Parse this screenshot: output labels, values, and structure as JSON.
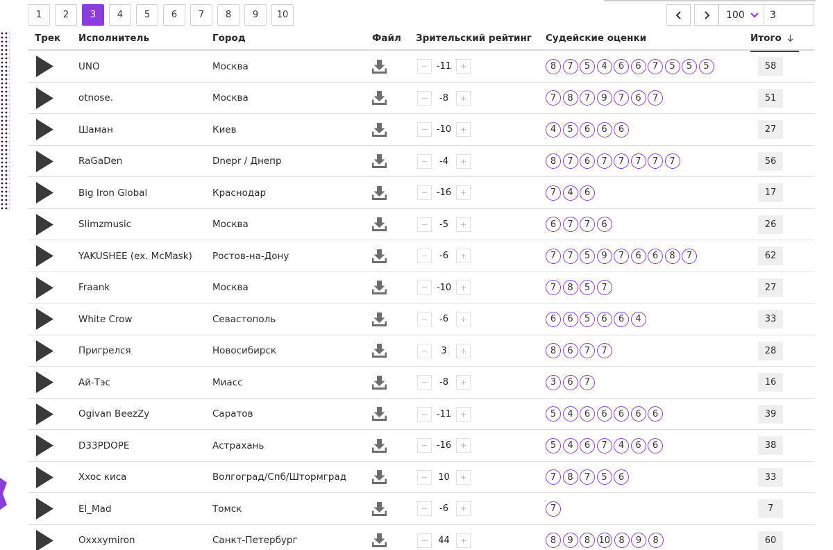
{
  "pagination": {
    "pages": [
      "1",
      "2",
      "3",
      "4",
      "5",
      "6",
      "7",
      "8",
      "9",
      "10"
    ],
    "active_index": 2,
    "per_page": "100",
    "page_input": "3"
  },
  "colors": {
    "accent": "#8a3ddb",
    "dark": "#3a1433"
  },
  "icons": {
    "play": "play-icon",
    "download": "download-icon",
    "prev": "chevron-left-icon",
    "next": "chevron-right-icon",
    "sort": "arrow-down-icon",
    "dropdown": "chevron-down-icon"
  },
  "table": {
    "headers": {
      "track": "Трек",
      "artist": "Исполнитель",
      "city": "Город",
      "file": "Файл",
      "rating": "Зрительский рейтинг",
      "scores": "Судейские оценки",
      "total": "Итого"
    },
    "minus": "−",
    "plus": "+",
    "rows": [
      {
        "artist": "UNO",
        "city": "Москва",
        "rating": "-11",
        "scores": [
          "8",
          "7",
          "5",
          "4",
          "6",
          "6",
          "7",
          "5",
          "5",
          "5"
        ],
        "total": "58"
      },
      {
        "artist": "otnose.",
        "city": "Москва",
        "rating": "-8",
        "scores": [
          "7",
          "8",
          "7",
          "9",
          "7",
          "6",
          "7"
        ],
        "total": "51"
      },
      {
        "artist": "Шаман",
        "city": "Киев",
        "rating": "-10",
        "scores": [
          "4",
          "5",
          "6",
          "6",
          "6"
        ],
        "total": "27"
      },
      {
        "artist": "RaGaDen",
        "city": "Dnepr / Днепр",
        "rating": "-4",
        "scores": [
          "8",
          "7",
          "6",
          "7",
          "7",
          "7",
          "7",
          "7"
        ],
        "total": "56"
      },
      {
        "artist": "Big Iron Global",
        "city": "Краснодар",
        "rating": "-16",
        "scores": [
          "7",
          "4",
          "6"
        ],
        "total": "17"
      },
      {
        "artist": "Slimzmusic",
        "city": "Москва",
        "rating": "-5",
        "scores": [
          "6",
          "7",
          "7",
          "6"
        ],
        "total": "26"
      },
      {
        "artist": "YAKUSHEE (ex. McMask)",
        "city": "Ростов-на-Дону",
        "rating": "-6",
        "scores": [
          "7",
          "7",
          "5",
          "9",
          "7",
          "6",
          "6",
          "8",
          "7"
        ],
        "total": "62"
      },
      {
        "artist": "Fraank",
        "city": "Москва",
        "rating": "-10",
        "scores": [
          "7",
          "8",
          "5",
          "7"
        ],
        "total": "27"
      },
      {
        "artist": "White Crow",
        "city": "Севастополь",
        "rating": "-6",
        "scores": [
          "6",
          "6",
          "5",
          "6",
          "6",
          "4"
        ],
        "total": "33"
      },
      {
        "artist": "Пригрелся",
        "city": "Новосибирск",
        "rating": "3",
        "scores": [
          "8",
          "6",
          "7",
          "7"
        ],
        "total": "28"
      },
      {
        "artist": "Ай-Тэс",
        "city": "Миасс",
        "rating": "-8",
        "scores": [
          "3",
          "6",
          "7"
        ],
        "total": "16"
      },
      {
        "artist": "Ogivan BeezZy",
        "city": "Саратов",
        "rating": "-11",
        "scores": [
          "5",
          "4",
          "6",
          "6",
          "6",
          "6",
          "6"
        ],
        "total": "39"
      },
      {
        "artist": "D33PDOPE",
        "city": "Астрахань",
        "rating": "-16",
        "scores": [
          "5",
          "4",
          "6",
          "7",
          "4",
          "6",
          "6"
        ],
        "total": "38"
      },
      {
        "artist": "Xxoc киса",
        "city": "Волгоград/Спб/Штормград",
        "rating": "10",
        "scores": [
          "7",
          "8",
          "7",
          "5",
          "6"
        ],
        "total": "33"
      },
      {
        "artist": "El_Mad",
        "city": "Томск",
        "rating": "-6",
        "scores": [
          "7"
        ],
        "total": "7"
      },
      {
        "artist": "Oxxxymiron",
        "city": "Санкт-Петербург",
        "rating": "44",
        "scores": [
          "8",
          "9",
          "8",
          "10",
          "8",
          "9",
          "8"
        ],
        "total": "60"
      }
    ]
  }
}
